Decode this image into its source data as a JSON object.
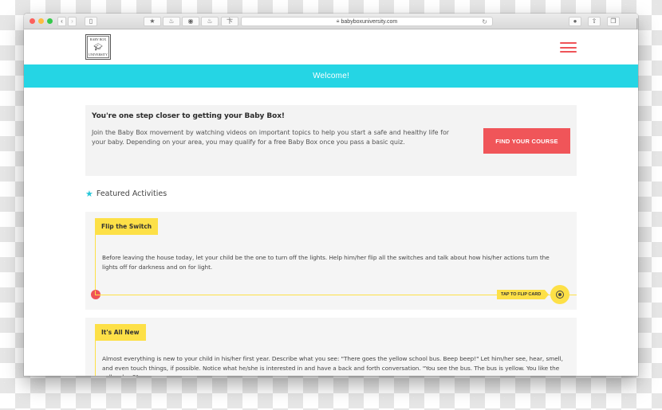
{
  "browser": {
    "url": "babyboxuniversity.com",
    "lock_icon": "lock-icon",
    "traffic_lights": [
      "#fc605c",
      "#fdbc40",
      "#34c84a"
    ],
    "toolbar_icons": [
      "back-icon",
      "forward-icon",
      "sidebar-icon",
      "bookmark-icon",
      "extension-icon",
      "extension-icon",
      "extension-icon",
      "extension-icon"
    ],
    "right_icons": [
      "download-icon",
      "share-icon",
      "tabs-icon"
    ],
    "new_tab_label": "+"
  },
  "header": {
    "logo": {
      "top": "BABY BOX",
      "bottom": "UNIVERSITY"
    },
    "menu_icon": "hamburger-icon",
    "menu_color": "#ef5358"
  },
  "welcome": {
    "text": "Welcome!",
    "color": "#25d5e4"
  },
  "promo": {
    "title": "You're one step closer to getting your Baby Box!",
    "body": "Join the Baby Box movement by watching videos on important topics to help you start a safe and healthy life for your baby. Depending on your area, you may qualify for a free Baby Box once you pass a basic quiz.",
    "button_label": "FIND YOUR COURSE",
    "button_color": "#f05559"
  },
  "featured": {
    "heading": "Featured Activities",
    "icon": "star-icon",
    "accent": "#fde047",
    "cards": [
      {
        "title": "Flip the Switch",
        "body": "Before leaving the house today, let your child be the one to turn off the lights. Help him/her flip all the switches and talk about how his/her actions turn the lights off for darkness and on for light.",
        "flip_label": "TAP TO FLIP CARD"
      },
      {
        "title": "It's All New",
        "body": "Almost everything is new to your child in his/her first year. Describe what you see: \"There goes the yellow school bus. Beep beep!\" Let him/her see, hear, smell, and even touch things, if possible. Notice what he/she is interested in and have a back and forth conversation. \"You see the bus. The bus is yellow. You like the yellow bus?\""
      }
    ]
  }
}
